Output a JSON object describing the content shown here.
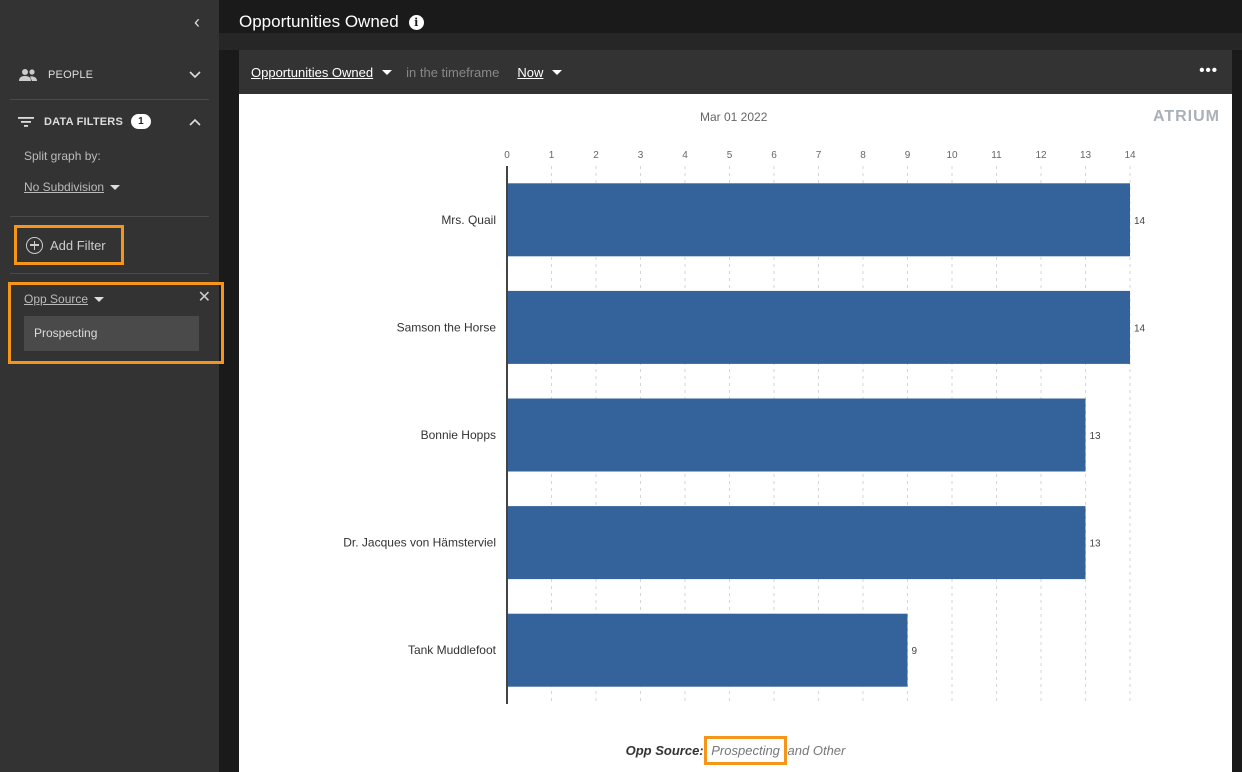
{
  "sidebar": {
    "collapse_icon": "chevron-left-icon",
    "people_label": "PEOPLE",
    "data_filters_label": "DATA FILTERS",
    "data_filters_count": "1",
    "split_label": "Split graph by:",
    "split_value": "No Subdivision",
    "add_filter_label": "Add Filter",
    "filter": {
      "name": "Opp Source",
      "value": "Prospecting"
    }
  },
  "page_title": "Opportunities Owned",
  "card": {
    "metric": "Opportunities Owned",
    "timeframe_text": "in the timeframe",
    "timeframe_value": "Now",
    "menu": "•••",
    "logo": "ATRIUM",
    "date_label": "Mar 01 2022"
  },
  "legend": {
    "key": "Opp Source:",
    "highlight": "Prospecting",
    "rest": "and Other"
  },
  "colors": {
    "bar": "#33639a",
    "accent": "#f5961b"
  },
  "chart_data": {
    "type": "bar",
    "orientation": "horizontal",
    "categories": [
      "Mrs. Quail",
      "Samson the Horse",
      "Bonnie Hopps",
      "Dr. Jacques von Hämsterviel",
      "Tank Muddlefoot"
    ],
    "values": [
      14,
      14,
      13,
      13,
      9
    ],
    "x_ticks": [
      "0",
      "1",
      "2",
      "3",
      "4",
      "5",
      "6",
      "7",
      "8",
      "9",
      "10",
      "11",
      "12",
      "13",
      "14"
    ],
    "xlim": [
      0,
      14
    ],
    "grid": true
  }
}
